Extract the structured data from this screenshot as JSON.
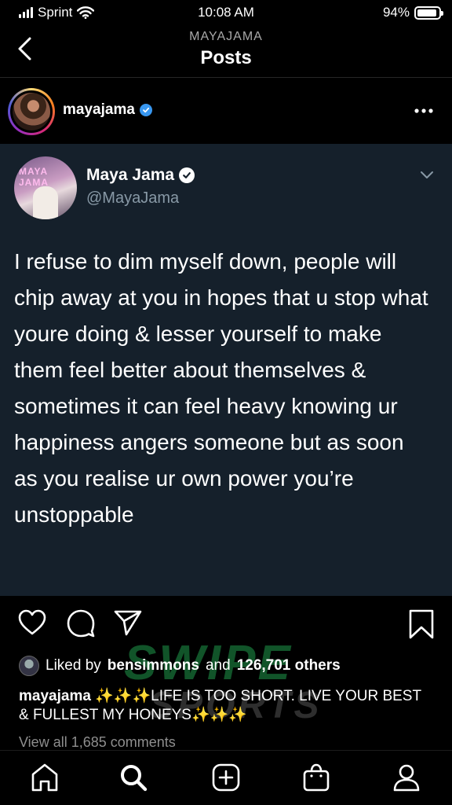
{
  "status_bar": {
    "carrier": "Sprint",
    "time": "10:08 AM",
    "battery": "94%",
    "battery_level": 0.94
  },
  "nav": {
    "subtitle": "MAYAJAMA",
    "title": "Posts"
  },
  "post": {
    "username": "mayajama",
    "verified": true
  },
  "tweet": {
    "name": "Maya Jama",
    "handle": "@MayaJama",
    "text": "I refuse to dim myself down, people will chip away at you in hopes that u stop what youre doing & lesser yourself to make them feel better about themselves & sometimes it can feel heavy knowing ur happiness angers someone but as soon as you realise ur own power you’re unstoppable",
    "background_color": "#15202b"
  },
  "likes": {
    "prefix": "Liked by",
    "user": "bensimmons",
    "middle": "and",
    "count_text": "126,701 others"
  },
  "caption": {
    "user": "mayajama",
    "text": "✨✨✨LIFE IS TOO SHORT. LIVE YOUR BEST & FULLEST MY HONEYS✨✨✨"
  },
  "comments": {
    "view_all": "View all 1,685 comments"
  },
  "watermark": {
    "line1": "SWIPE",
    "line2": "SPORTS"
  },
  "icons": {
    "back": "chevron-left-icon",
    "more": "more-horizontal-icon",
    "like": "heart-icon",
    "comment": "comment-icon",
    "share": "send-icon",
    "save": "bookmark-icon",
    "home": "home-icon",
    "search": "search-icon",
    "create": "plus-square-icon",
    "shop": "shopping-bag-icon",
    "profile": "profile-icon"
  }
}
